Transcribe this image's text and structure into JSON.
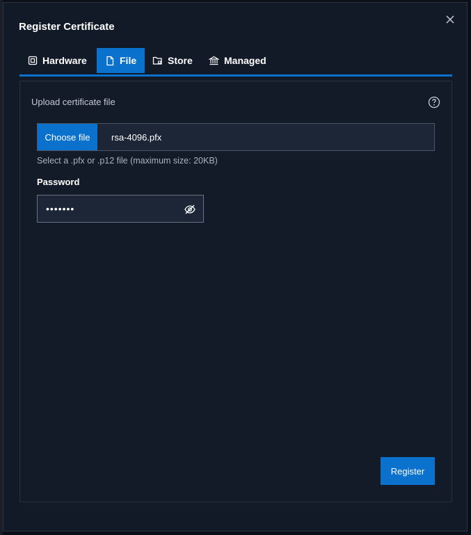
{
  "dialog": {
    "title": "Register Certificate"
  },
  "tabs": [
    {
      "label": "Hardware",
      "icon": "hardware-icon",
      "active": false
    },
    {
      "label": "File",
      "icon": "file-icon",
      "active": true
    },
    {
      "label": "Store",
      "icon": "store-icon",
      "active": false
    },
    {
      "label": "Managed",
      "icon": "managed-icon",
      "active": false
    }
  ],
  "upload": {
    "label": "Upload certificate file",
    "choose_button": "Choose file",
    "file_name": "rsa-4096.pfx",
    "help_text": "Select a .pfx or .p12 file (maximum size: 20KB)"
  },
  "password": {
    "label": "Password",
    "masked_value": "•••••••"
  },
  "actions": {
    "register": "Register"
  },
  "colors": {
    "accent": "#0a72cc",
    "dialog_bg": "#121a28",
    "field_bg": "#1c2637"
  }
}
